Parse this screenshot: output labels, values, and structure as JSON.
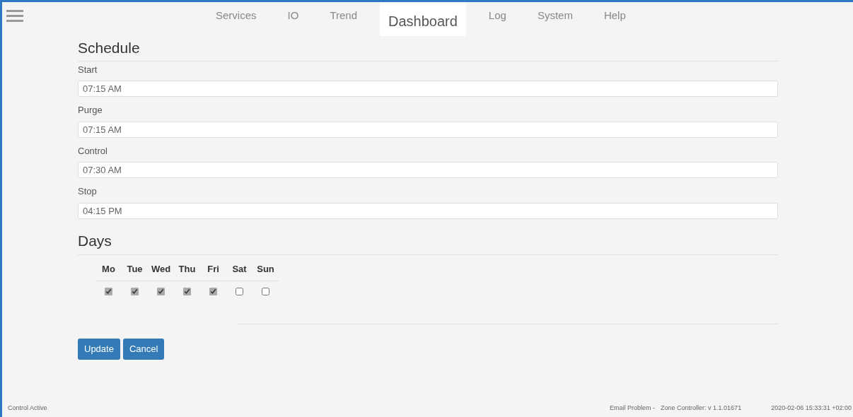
{
  "nav": [
    {
      "label": "Services",
      "selected": false
    },
    {
      "label": "IO",
      "selected": false
    },
    {
      "label": "Trend",
      "selected": false
    },
    {
      "label": "Dashboard",
      "selected": true
    },
    {
      "label": "Log",
      "selected": false
    },
    {
      "label": "System",
      "selected": false
    },
    {
      "label": "Help",
      "selected": false
    }
  ],
  "schedule": {
    "title": "Schedule",
    "fields": [
      {
        "label": "Start",
        "value": "07:15 AM"
      },
      {
        "label": "Purge",
        "value": "07:15 AM"
      },
      {
        "label": "Control",
        "value": "07:30 AM"
      },
      {
        "label": "Stop",
        "value": "04:15 PM"
      }
    ]
  },
  "days": {
    "title": "Days",
    "items": [
      {
        "label": "Mo",
        "checked": true
      },
      {
        "label": "Tue",
        "checked": true
      },
      {
        "label": "Wed",
        "checked": true
      },
      {
        "label": "Thu",
        "checked": true
      },
      {
        "label": "Fri",
        "checked": true
      },
      {
        "label": "Sat",
        "checked": false
      },
      {
        "label": "Sun",
        "checked": false
      }
    ]
  },
  "buttons": [
    "Update",
    "Cancel"
  ],
  "status_bar": {
    "left": "Control Active",
    "email": "Email Problem -",
    "version": "Zone Controller: v 1.1.01671",
    "time": "2020-02-06 15:33:31 +02:00"
  }
}
